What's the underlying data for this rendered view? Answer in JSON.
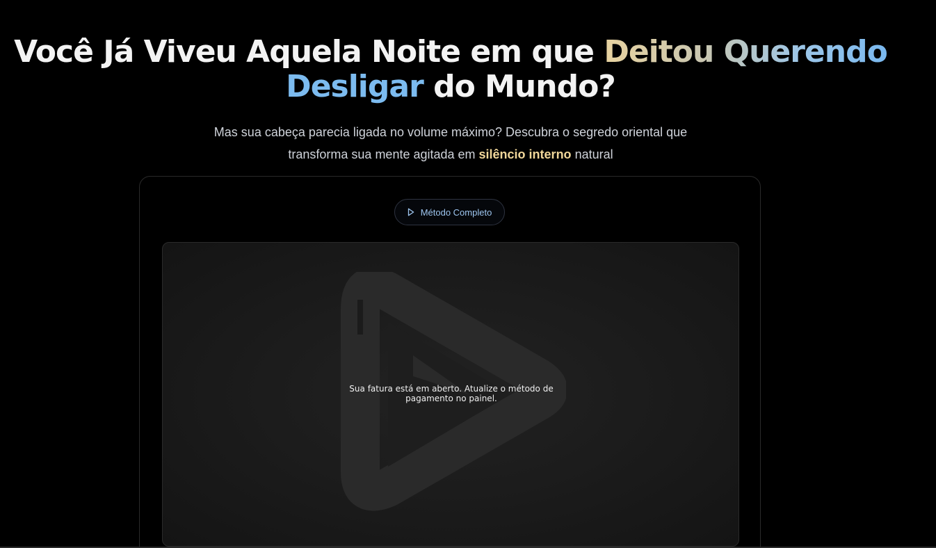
{
  "hero": {
    "headline_part1": "Você Já Viveu Aquela Noite em que ",
    "headline_highlight1": "Deitou Querendo",
    "headline_highlight2": "Desligar",
    "headline_part2": " do Mundo?",
    "subtitle_part1": "Mas sua cabeça parecia ligada no volume máximo? Descubra o segredo oriental que",
    "subtitle_part2": "transforma sua mente agitada em ",
    "subtitle_highlight": "silêncio interno",
    "subtitle_part3": " natural"
  },
  "video_card": {
    "button_label": "Método Completo",
    "button_icon": "play-icon",
    "player_logo_icon": "video-player-logo-icon",
    "message_line1": "Sua fatura está em aberto. Atualize o método de",
    "message_line2": "pagamento no painel."
  },
  "colors": {
    "background": "#000000",
    "headline": "#f3f3f3",
    "gold_accent": "#f1d79a",
    "blue_accent": "#7cbbef",
    "button_text": "#9ec6f0"
  }
}
